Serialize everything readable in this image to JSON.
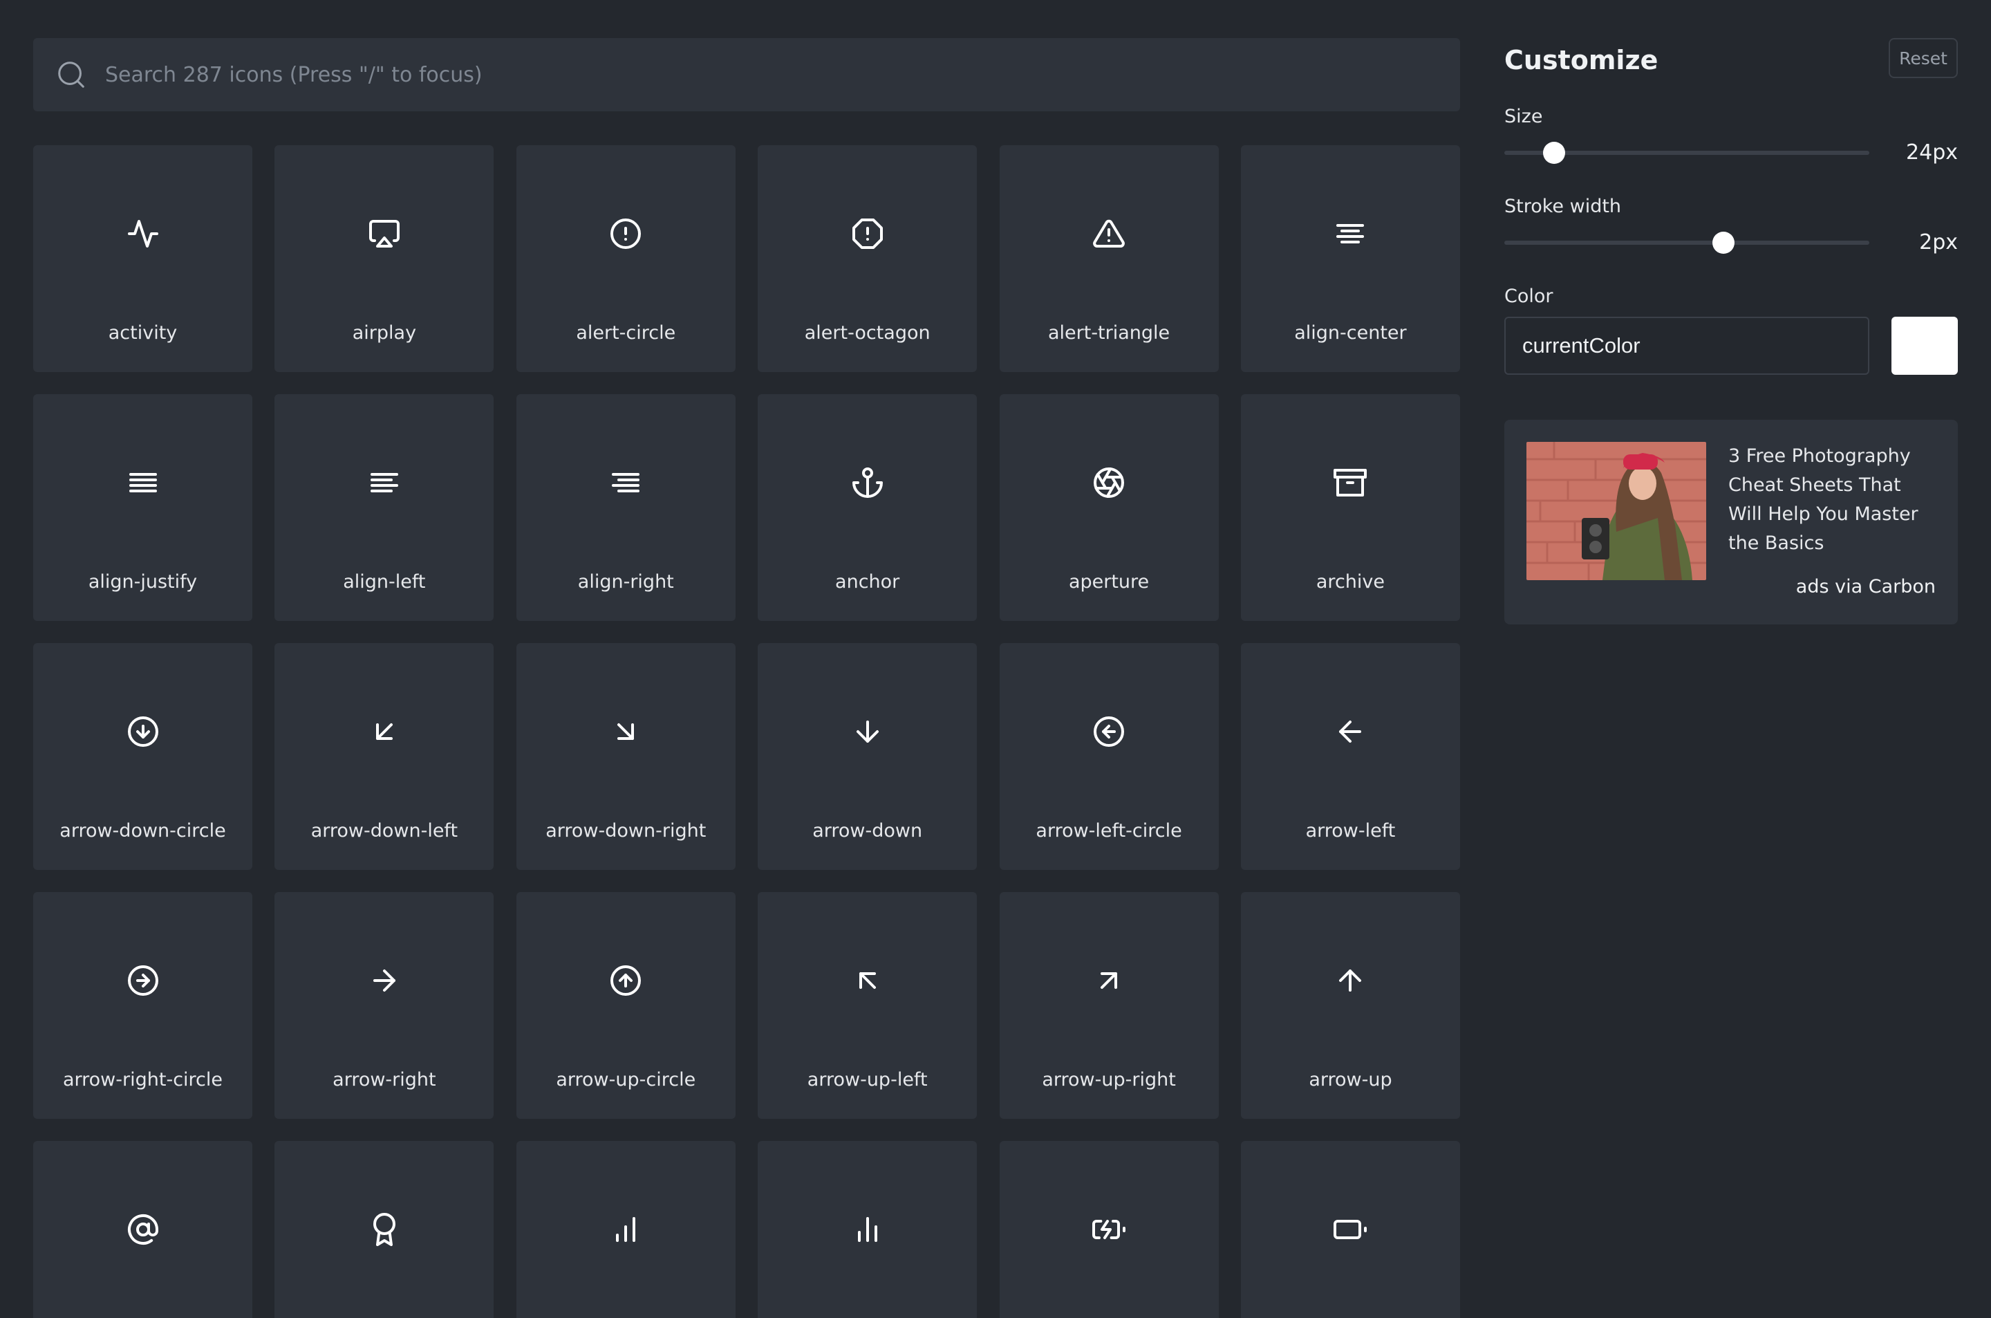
{
  "search": {
    "placeholder": "Search 287 icons (Press \"/\" to focus)"
  },
  "icons": [
    {
      "name": "activity"
    },
    {
      "name": "airplay"
    },
    {
      "name": "alert-circle"
    },
    {
      "name": "alert-octagon"
    },
    {
      "name": "alert-triangle"
    },
    {
      "name": "align-center"
    },
    {
      "name": "align-justify"
    },
    {
      "name": "align-left"
    },
    {
      "name": "align-right"
    },
    {
      "name": "anchor"
    },
    {
      "name": "aperture"
    },
    {
      "name": "archive"
    },
    {
      "name": "arrow-down-circle"
    },
    {
      "name": "arrow-down-left"
    },
    {
      "name": "arrow-down-right"
    },
    {
      "name": "arrow-down"
    },
    {
      "name": "arrow-left-circle"
    },
    {
      "name": "arrow-left"
    },
    {
      "name": "arrow-right-circle"
    },
    {
      "name": "arrow-right"
    },
    {
      "name": "arrow-up-circle"
    },
    {
      "name": "arrow-up-left"
    },
    {
      "name": "arrow-up-right"
    },
    {
      "name": "arrow-up"
    },
    {
      "name": "at-sign"
    },
    {
      "name": "award"
    },
    {
      "name": "bar-chart"
    },
    {
      "name": "bar-chart-2"
    },
    {
      "name": "battery-charging"
    },
    {
      "name": "battery"
    }
  ],
  "customize": {
    "title": "Customize",
    "reset_label": "Reset",
    "size": {
      "label": "Size",
      "value_label": "24px",
      "value": 24,
      "min": 12,
      "max": 100
    },
    "stroke": {
      "label": "Stroke width",
      "value_label": "2px",
      "value": 2,
      "min": 0.5,
      "max": 3
    },
    "color": {
      "label": "Color",
      "value": "currentColor",
      "swatch": "#ffffff"
    }
  },
  "ad": {
    "text": "3 Free Photography Cheat Sheets That Will Help You Master the Basics",
    "via": "ads via Carbon"
  },
  "colors": {
    "background": "#24282e",
    "tile": "#2e333b",
    "text": "#e6e8eb",
    "muted": "#7f8792"
  }
}
